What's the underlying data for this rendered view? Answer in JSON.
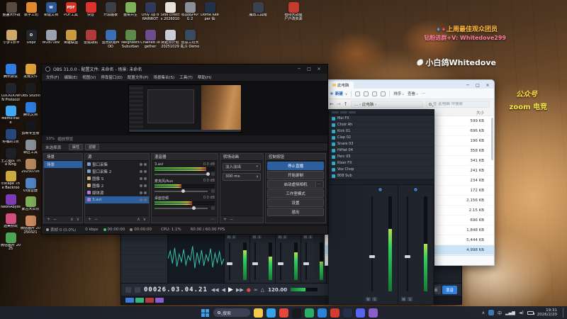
{
  "overlay": {
    "line1": "上周最佳观众团员",
    "line2": "钻粉进群+V: Whitedove299",
    "line3": "小白鸽Whitedove",
    "line4": "公众号",
    "line5": "zoom 电竞"
  },
  "desktop_icons": {
    "row1": [
      {
        "label": "整蛊大作战",
        "c": "#5a4a42"
      },
      {
        "label": "数字工坊",
        "c": "#e08a2e"
      },
      {
        "label": "新建文档",
        "c": "#2b5797",
        "g": "W"
      },
      {
        "label": "PDF工具",
        "c": "#d93025",
        "g": "PDF"
      },
      {
        "label": "快音",
        "c": "#e03131"
      },
      {
        "label": "开源画板",
        "c": "#3b3f46"
      },
      {
        "label": "鱼菜共生",
        "c": "#7fb15a"
      },
      {
        "label": "Only Up BRAINROT",
        "c": "#2e3a57"
      },
      {
        "label": "Side Effects 2026010",
        "c": "#e7e2da"
      },
      {
        "label": "收款码PKPG 2",
        "c": "#8a9099"
      },
      {
        "label": "Dome Keeper 仙",
        "c": "#23304a"
      }
    ],
    "row1_extra": [
      {
        "label": "魔改工具箱",
        "c": "#39424e"
      },
      {
        "label": "植物大战僵尸户改资源",
        "c": "#c23b2e"
      }
    ],
    "row2": [
      {
        "label": "小梦1点半",
        "c": "#caa96b"
      },
      {
        "label": "Oopz",
        "c": "#23262b",
        "g": "O"
      },
      {
        "label": "bf2d71b9",
        "c": "#9aa2ad"
      },
      {
        "label": "英雄联盟",
        "c": "#c99a3f"
      },
      {
        "label": "雷霆战机",
        "c": "#b03a3a"
      },
      {
        "label": "蓝色妖姬MOD",
        "c": "#3b6fb5"
      },
      {
        "label": "Neighbors Suburban",
        "c": "#5d8a4a"
      },
      {
        "label": "Chained Together",
        "c": "#704b8f"
      },
      {
        "label": "新起点计划 20251029",
        "c": "#c7cdd6"
      },
      {
        "label": "创意工坊大乱斗 Demo",
        "c": "#394a61"
      }
    ],
    "col1": [
      {
        "label": "腾讯会议",
        "c": "#2f7de1"
      },
      {
        "label": "LOCKDOWN Protocol",
        "c": "#20242b"
      },
      {
        "label": "MemoTrace",
        "c": "#3fa9f5"
      },
      {
        "label": "籽岷的1点",
        "c": "#27477a"
      },
      {
        "label": "王之猎队 The King",
        "c": "#1d2026"
      },
      {
        "label": "Escape The Backrooms",
        "c": "#caa93f"
      },
      {
        "label": "NeonAbyss",
        "c": "#7a3bb5"
      },
      {
        "label": "选美别玩",
        "c": "#d14f7e"
      },
      {
        "label": "微信图片 2025",
        "c": "#4ba356"
      }
    ],
    "col2": [
      {
        "label": "发我文件",
        "c": "#e0a23a"
      },
      {
        "label": "OBS Studio",
        "c": "#1d1d1f"
      },
      {
        "label": "腾讯文档",
        "c": "#2f7de1"
      },
      {
        "label": "剪映专业版",
        "c": "#16181d"
      },
      {
        "label": "转区工具",
        "c": "#8a9099"
      },
      {
        "label": "20250708",
        "c": "#b58a5f"
      },
      {
        "label": "UI混音器",
        "c": "#4f86c6"
      },
      {
        "label": "蒙古大草原",
        "c": "#7fae5a"
      },
      {
        "label": "微信图片 20250321",
        "c": "#c98a5f"
      }
    ]
  },
  "obs": {
    "title": "OBS 31.0.0 - 配置文件: 未命名 - 场景: 未命名",
    "menu": [
      {
        "t": "文件(F)"
      },
      {
        "t": "编辑(E)"
      },
      {
        "t": "视图(V)"
      },
      {
        "t": "停靠窗口(D)"
      },
      {
        "t": "配置文件(P)"
      },
      {
        "t": "场景集合(S)"
      },
      {
        "t": "工具(T)"
      },
      {
        "t": "帮助(H)"
      }
    ],
    "zoom": "10%",
    "zoom_label": "缩放预览",
    "no_source": "未选择源",
    "btn_props": "属性",
    "btn_filters": "滤镜",
    "docks": {
      "scenes_title": "场景",
      "scenes": [
        {
          "t": "场景",
          "sel": true
        }
      ],
      "sources_title": "源",
      "sources": [
        {
          "t": "窗口采集",
          "c": "#7b9fd4"
        },
        {
          "t": "窗口采集 2",
          "c": "#7b9fd4"
        },
        {
          "t": "图像 S",
          "c": "#d4b47b"
        },
        {
          "t": "图像 2",
          "c": "#d4b47b"
        },
        {
          "t": "媒体源",
          "c": "#b07bd4"
        },
        {
          "t": "3.avi",
          "c": "#b07bd4",
          "sel": true
        }
      ],
      "mixer_title": "混音器",
      "channels": [
        {
          "name": "3.avi",
          "db": "0.0 dB",
          "lvl": 0.86
        },
        {
          "name": "麦克风/Aux",
          "db": "0.0 dB",
          "lvl": 0.45
        },
        {
          "name": "桌面音频",
          "db": "0.0 dB",
          "lvl": 0.62
        }
      ],
      "transitions_title": "转场动画",
      "transition": "淡入淡出",
      "duration": "300 ms",
      "controls_title": "控制按钮",
      "controls": [
        {
          "t": "停止直播",
          "sel": true
        },
        {
          "t": "开始录制"
        },
        {
          "t": "启动虚拟相机",
          "g": "flex"
        },
        {
          "t": "工作室模式"
        },
        {
          "t": "设置"
        },
        {
          "t": "退出"
        }
      ]
    },
    "status": [
      {
        "t": "丢帧 0 (0.0%)",
        "dot": "#9a9aa0"
      },
      {
        "t": "0 kbps"
      },
      {
        "t": "00:00:00",
        "dot": "#43c45e"
      },
      {
        "t": "00:00:00",
        "dot": "#8a8a90"
      },
      {
        "t": "CPU: 1.1%"
      },
      {
        "t": "60.00 / 60.00 FPS"
      }
    ]
  },
  "explorer": {
    "tab": "此电脑",
    "new_label": "新建",
    "sort_label": "排序",
    "view_label": "查看",
    "more_label": "⋯",
    "breadcrumb": "…  ›  此电脑  ›",
    "search_placeholder": "在 此电脑 中搜索",
    "col_size": "大小",
    "files": [
      {
        "v": "599 KB"
      },
      {
        "v": "696 KB"
      },
      {
        "v": "196 KB"
      },
      {
        "v": "358 KB"
      },
      {
        "v": "341 KB"
      },
      {
        "v": "241 KB"
      },
      {
        "v": "234 KB"
      },
      {
        "v": "172 KB"
      },
      {
        "v": "2,156 KB"
      },
      {
        "v": "2.15 KB"
      },
      {
        "v": "696 KB"
      },
      {
        "v": "1,848 KB"
      },
      {
        "v": "5,444 KB"
      },
      {
        "v": "4,998 KB",
        "sel": true
      }
    ]
  },
  "daw": {
    "timecode": "00026.03.04.21",
    "tempo": "120.00",
    "edit_label": "编辑",
    "mix_label": "混音",
    "rack": [
      {
        "n": "Mai FX"
      },
      {
        "n": "Choir Ah"
      },
      {
        "n": "Kick 01"
      },
      {
        "n": "Clap 02"
      },
      {
        "n": "Snare 03"
      },
      {
        "n": "HiHat 04"
      },
      {
        "n": "Perc 05"
      },
      {
        "n": "Riser FX"
      },
      {
        "n": "Vox Chop"
      },
      {
        "n": "808 Sub"
      }
    ],
    "big_levels": [
      {
        "lvl": 0.8
      },
      {
        "lvl": 0.62
      },
      {
        "lvl": 0.74
      },
      {
        "lvl": 0.5
      }
    ],
    "small_levels": [
      {
        "lvl": 0.55
      },
      {
        "lvl": 0.7
      },
      {
        "lvl": 0.42
      },
      {
        "lvl": 0.66
      },
      {
        "lvl": 0.5
      },
      {
        "lvl": 0.6
      }
    ],
    "rack_levels": [
      {
        "lvl": 0.66
      },
      {
        "lvl": 0.5
      }
    ]
  },
  "taskbar": {
    "search": "搜索",
    "ime": "中",
    "time": "19:31",
    "date": "2026/2/20",
    "apps": [
      {
        "name": "file-explorer",
        "c": "#f3c84b"
      },
      {
        "name": "edge",
        "c": "#35a3e8"
      },
      {
        "name": "browser",
        "c": "#e8453c"
      },
      {
        "name": "obs",
        "c": "#1a1a1e"
      },
      {
        "name": "wechat",
        "c": "#2aae67"
      },
      {
        "name": "qq",
        "c": "#2b82d9"
      },
      {
        "name": "music",
        "c": "#d43c33"
      },
      {
        "name": "steam",
        "c": "#233047"
      },
      {
        "name": "discord",
        "c": "#5865f2"
      },
      {
        "name": "game",
        "c": "#8a5fc9"
      }
    ]
  }
}
